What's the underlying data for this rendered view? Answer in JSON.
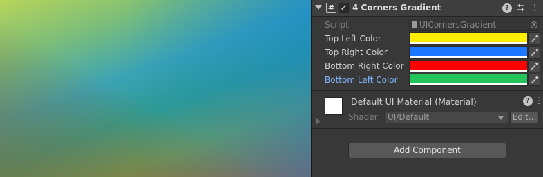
{
  "component": {
    "title": "4 Corners Gradient",
    "enabled": true,
    "icons": [
      "hash-icon",
      "checkbox-icon",
      "help-icon",
      "preset-icon",
      "more-icon"
    ]
  },
  "fields": {
    "script": {
      "label": "Script",
      "value": "UICornersGradient"
    },
    "colors": [
      {
        "label": "Top Left Color",
        "color": "#ffee00"
      },
      {
        "label": "Top Right Color",
        "color": "#1e78ff"
      },
      {
        "label": "Bottom Right Color",
        "color": "#ff0000"
      },
      {
        "label": "Bottom Left Color",
        "color": "#24c45a"
      }
    ]
  },
  "material": {
    "title": "Default UI Material (Material)",
    "shader_label": "Shader",
    "shader_value": "UI/Default",
    "edit_label": "Edit..."
  },
  "add_component_label": "Add Component"
}
